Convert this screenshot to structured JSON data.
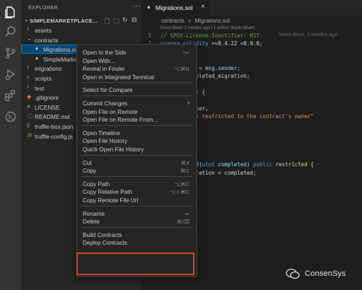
{
  "activity_bar": {
    "icons": [
      "files-icon",
      "search-icon",
      "source-control-icon",
      "run-debug-icon",
      "extensions-icon",
      "remote-icon"
    ]
  },
  "sidebar": {
    "title": "EXPLORER",
    "more": "···",
    "section_title": "SIMPLEMARKETPLACE...",
    "tree": [
      {
        "label": "assets",
        "kind": "folder",
        "expanded": false
      },
      {
        "label": "contracts",
        "kind": "folder",
        "expanded": true
      },
      {
        "label": "Migrations.sol",
        "kind": "sol",
        "selected": true
      },
      {
        "label": "SimpleMarket",
        "kind": "sol"
      },
      {
        "label": "migrations",
        "kind": "folder",
        "expanded": false
      },
      {
        "label": "scripts",
        "kind": "folder",
        "expanded": false
      },
      {
        "label": "test",
        "kind": "folder",
        "expanded": false
      },
      {
        "label": ".gitignore",
        "kind": "git"
      },
      {
        "label": "LICENSE",
        "kind": "license"
      },
      {
        "label": "README.md",
        "kind": "md"
      },
      {
        "label": "truffle-box.json",
        "kind": "json"
      },
      {
        "label": "truffle-config.js",
        "kind": "js"
      }
    ]
  },
  "editor": {
    "tab_label": "Migrations.sol",
    "breadcrumbs": [
      "contracts",
      ">",
      "Migrations.sol"
    ],
    "blame_header": "Kevin Bluer, 2 months ago | 1 author (Kevin Bluer)",
    "inline_blame": "Kevin Bluer, 2 months ago",
    "lines": [
      {
        "n": "1",
        "parts": [
          [
            "c-comment",
            "// SPDX-License-Identifier: MIT"
          ]
        ]
      },
      {
        "n": "2",
        "parts": [
          [
            "c-kw",
            "pragma"
          ],
          [
            "c-plain",
            " "
          ],
          [
            "c-kw",
            "solidity"
          ],
          [
            "c-plain",
            " >=0.4.22 <0.9.0;"
          ]
        ]
      },
      {
        "n": "",
        "parts": []
      },
      {
        "n": "",
        "parts": [
          [
            "c-var",
            "grations"
          ],
          [
            "c-plain",
            " {"
          ]
        ]
      },
      {
        "n": "",
        "parts": [
          [
            "c-kw",
            "ublic"
          ],
          [
            "c-plain",
            " owner = "
          ],
          [
            "c-var",
            "msg"
          ],
          [
            "c-plain",
            "."
          ],
          [
            "c-var",
            "sender"
          ],
          [
            "c-plain",
            ";"
          ]
        ]
      },
      {
        "n": "",
        "parts": [
          [
            "c-kw",
            "ic"
          ],
          [
            "c-plain",
            " last_completed_migration;"
          ]
        ]
      },
      {
        "n": "",
        "parts": []
      },
      {
        "n": "",
        "parts": [
          [
            "c-fn",
            "restricted"
          ],
          [
            "c-plain",
            "() {"
          ]
        ]
      },
      {
        "n": "",
        "parts": []
      },
      {
        "n": "",
        "parts": [
          [
            "c-var",
            "ender"
          ],
          [
            "c-plain",
            " == owner,"
          ]
        ]
      },
      {
        "n": "",
        "parts": [
          [
            "c-str",
            " function is restricted to the contract's owner\""
          ]
        ]
      },
      {
        "n": "",
        "parts": []
      },
      {
        "n": "",
        "parts": []
      },
      {
        "n": "",
        "parts": []
      },
      {
        "n": "",
        "parts": []
      },
      {
        "n": "",
        "parts": []
      },
      {
        "n": "",
        "parts": [
          [
            "c-fn",
            "setCompleted"
          ],
          [
            "c-plain",
            "("
          ],
          [
            "c-kw",
            "uint"
          ],
          [
            "c-plain",
            " "
          ],
          [
            "c-var",
            "completed"
          ],
          [
            "c-plain",
            ") "
          ],
          [
            "c-kw",
            "public"
          ],
          [
            "c-plain",
            " "
          ],
          [
            "c-fn",
            "restricted"
          ],
          [
            "c-plain",
            " {"
          ]
        ]
      },
      {
        "n": "",
        "parts": [
          [
            "c-plain",
            "mpleted_migration = completed;"
          ]
        ]
      }
    ]
  },
  "context_menu": {
    "items": [
      {
        "label": "Open to the Side",
        "shortcut": "^↩"
      },
      {
        "label": "Open With...",
        "shortcut": ""
      },
      {
        "label": "Reveal in Finder",
        "shortcut": "⌥⌘R"
      },
      {
        "label": "Open in Integrated Terminal",
        "shortcut": ""
      },
      {
        "sep": true
      },
      {
        "label": "Select for Compare",
        "shortcut": ""
      },
      {
        "sep": true
      },
      {
        "label": "Commit Changes",
        "shortcut": "›"
      },
      {
        "label": "Open File on Remote",
        "shortcut": ""
      },
      {
        "label": "Open File on Remote From...",
        "shortcut": ""
      },
      {
        "sep": true
      },
      {
        "label": "Open Timeline",
        "shortcut": ""
      },
      {
        "label": "Open File History",
        "shortcut": ""
      },
      {
        "label": "Quick Open File History",
        "shortcut": ""
      },
      {
        "sep": true
      },
      {
        "label": "Cut",
        "shortcut": "⌘X"
      },
      {
        "label": "Copy",
        "shortcut": "⌘C"
      },
      {
        "sep": true
      },
      {
        "label": "Copy Path",
        "shortcut": "⌥⌘C"
      },
      {
        "label": "Copy Relative Path",
        "shortcut": "⌥⇧⌘C"
      },
      {
        "label": "Copy Remote File Url",
        "shortcut": ""
      },
      {
        "sep": true
      },
      {
        "label": "Rename",
        "shortcut": "↩"
      },
      {
        "label": "Delete",
        "shortcut": "⌘⌫"
      },
      {
        "sep": true
      },
      {
        "label": "Build Contracts",
        "shortcut": ""
      },
      {
        "label": "Deploy Contracts",
        "shortcut": ""
      }
    ]
  },
  "brand": {
    "name": "ConsenSys"
  },
  "colors": {
    "accent_highlight": "#d9412b",
    "selection": "#094771"
  }
}
